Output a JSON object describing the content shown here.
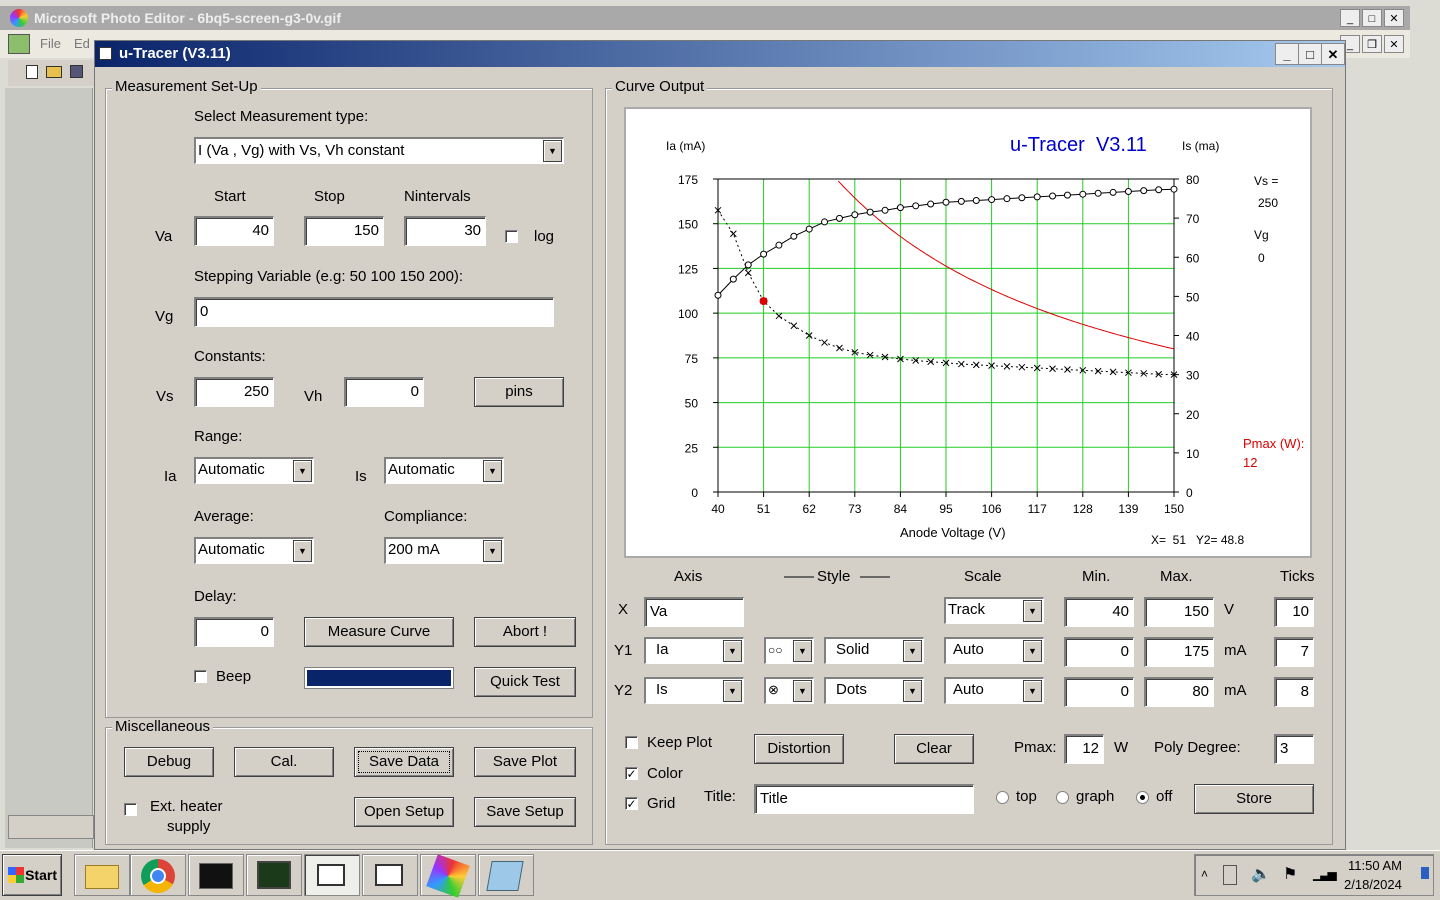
{
  "photo_editor": {
    "title": "Microsoft Photo Editor - 6bq5-screen-g3-0v.gif",
    "menu_file": "File",
    "menu_edit": "Ed"
  },
  "window": {
    "title": "u-Tracer (V3.11)"
  },
  "setup": {
    "group_label": "Measurement Set-Up",
    "select_type_label": "Select Measurement type:",
    "measurement_type": "I (Va , Vg) with Vs, Vh constant",
    "start_label": "Start",
    "stop_label": "Stop",
    "nintervals_label": "Nintervals",
    "va_label": "Va",
    "va_start": "40",
    "va_stop": "150",
    "va_nintervals": "30",
    "log_label": "log",
    "log_checked": false,
    "stepping_label": "Stepping Variable (e.g: 50 100 150 200):",
    "vg_label": "Vg",
    "vg_value": "0",
    "constants_label": "Constants:",
    "vs_label": "Vs",
    "vs_value": "250",
    "vh_label": "Vh",
    "vh_value": "0",
    "pins_label": "pins",
    "range_label": "Range:",
    "ia_label": "Ia",
    "ia_range": "Automatic",
    "is_label": "Is",
    "is_range": "Automatic",
    "average_label": "Average:",
    "average_value": "Automatic",
    "compliance_label": "Compliance:",
    "compliance_value": "200 mA",
    "delay_label": "Delay:",
    "delay_value": "0",
    "measure_label": "Measure Curve",
    "abort_label": "Abort !",
    "beep_label": "Beep",
    "beep_checked": false,
    "quicktest_label": "Quick Test",
    "progress": 1.0
  },
  "misc": {
    "group_label": "Miscellaneous",
    "debug": "Debug",
    "cal": "Cal.",
    "save_data": "Save Data",
    "save_plot": "Save Plot",
    "ext_heater_1": "Ext. heater",
    "ext_heater_2": "supply",
    "ext_heater_checked": false,
    "open_setup": "Open Setup",
    "save_setup": "Save Setup"
  },
  "curve": {
    "group_label": "Curve Output",
    "axis_hdr": "Axis",
    "style_hdr": "Style",
    "scale_hdr": "Scale",
    "min_hdr": "Min.",
    "max_hdr": "Max.",
    "ticks_hdr": "Ticks",
    "rows": [
      {
        "axis": "X",
        "var": "Va",
        "scale": "Track",
        "min": "40",
        "max": "150",
        "unit": "V",
        "ticks": "10"
      },
      {
        "axis": "Y1",
        "var": "Ia",
        "line": "Solid",
        "scale": "Auto",
        "min": "0",
        "max": "175",
        "unit": "mA",
        "ticks": "7"
      },
      {
        "axis": "Y2",
        "var": "Is",
        "line": "Dots",
        "scale": "Auto",
        "min": "0",
        "max": "80",
        "unit": "mA",
        "ticks": "8"
      }
    ],
    "keep_plot": "Keep Plot",
    "keep_plot_checked": false,
    "color": "Color",
    "color_checked": true,
    "grid": "Grid",
    "grid_checked": true,
    "distortion": "Distortion",
    "clear": "Clear",
    "pmax_label": "Pmax:",
    "pmax_value": "12",
    "pmax_unit": "W",
    "poly_label": "Poly Degree:",
    "poly_value": "3",
    "title_label": "Title:",
    "title_value": "Title",
    "radio_top": "top",
    "radio_graph": "graph",
    "radio_off": "off",
    "radio_selected": "off",
    "store": "Store"
  },
  "chart_data": {
    "type": "line",
    "title": "u-Tracer  V3.11",
    "xlabel": "Anode Voltage (V)",
    "ylabel_left": "Ia (mA)",
    "ylabel_right": "Is (ma)",
    "xlim": [
      40,
      150
    ],
    "ylim_left": [
      0,
      175
    ],
    "ylim_right": [
      0,
      80
    ],
    "x_ticks": [
      "40",
      "51",
      "62",
      "73",
      "84",
      "95",
      "106",
      "117",
      "128",
      "139",
      "150"
    ],
    "y_ticks_left": [
      "0",
      "25",
      "50",
      "75",
      "100",
      "125",
      "150",
      "175"
    ],
    "y_ticks_right": [
      "0",
      "10",
      "20",
      "30",
      "40",
      "50",
      "60",
      "70",
      "80"
    ],
    "grid": true,
    "side_vs_label": "Vs =",
    "side_vs_value": "250",
    "side_vg_label": "Vg",
    "side_vg_value": "0",
    "pmax_label": "Pmax (W):",
    "pmax_value": "12",
    "readout": "X=  51   Y2= 48.8",
    "colors": {
      "grid": "#22cc22",
      "pmax": "#dd0000",
      "title": "#0000cc",
      "marker": "#dd0000"
    },
    "series": [
      {
        "name": "Ia",
        "axis": "left",
        "style": "solid-circles",
        "x": [
          40,
          43.7,
          47.3,
          51,
          54.7,
          58.3,
          62,
          65.7,
          69.3,
          73,
          76.7,
          80.3,
          84,
          87.7,
          91.3,
          95,
          98.7,
          102.3,
          106,
          109.7,
          113.3,
          117,
          120.7,
          124.3,
          128,
          131.7,
          135.3,
          139,
          142.7,
          146.3,
          150
        ],
        "y": [
          110,
          119,
          127,
          133,
          138,
          143,
          147,
          151,
          153,
          155,
          156.5,
          157.5,
          159,
          160,
          161,
          162,
          162.5,
          163,
          163.5,
          164,
          164.5,
          165,
          165.5,
          166,
          166.5,
          167,
          167.5,
          168,
          168.5,
          169,
          169.3
        ]
      },
      {
        "name": "Is",
        "axis": "right",
        "style": "dotted-crosses",
        "x": [
          40,
          43.7,
          47.3,
          51,
          54.7,
          58.3,
          62,
          65.7,
          69.3,
          73,
          76.7,
          80.3,
          84,
          87.7,
          91.3,
          95,
          98.7,
          102.3,
          106,
          109.7,
          113.3,
          117,
          120.7,
          124.3,
          128,
          131.7,
          135.3,
          139,
          142.7,
          146.3,
          150
        ],
        "y": [
          72,
          66,
          56,
          48.8,
          45,
          42.5,
          40,
          38.2,
          36.8,
          35.7,
          35,
          34.5,
          34,
          33.6,
          33.3,
          33,
          32.7,
          32.5,
          32.3,
          32.1,
          31.9,
          31.7,
          31.5,
          31.3,
          31.1,
          30.9,
          30.7,
          30.5,
          30.3,
          30.1,
          30
        ]
      }
    ]
  },
  "taskbar": {
    "start": "Start",
    "time": "11:50 AM",
    "date": "2/18/2024"
  }
}
